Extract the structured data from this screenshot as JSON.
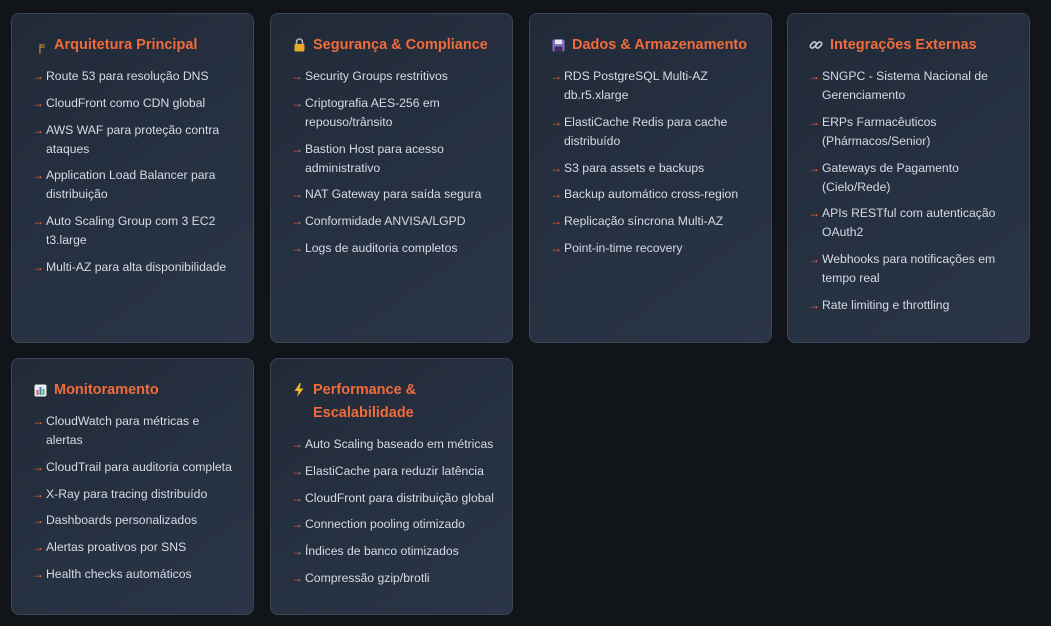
{
  "cards": [
    {
      "title": "Arquitetura Principal",
      "icon": "construction-crane-icon",
      "items": [
        "Route 53 para resolução DNS",
        "CloudFront como CDN global",
        "AWS WAF para proteção contra ataques",
        "Application Load Balancer para distribuição",
        "Auto Scaling Group com 3 EC2 t3.large",
        "Multi-AZ para alta disponibilidade"
      ]
    },
    {
      "title": "Segurança & Compliance",
      "icon": "lock-icon",
      "items": [
        "Security Groups restritivos",
        "Criptografia AES-256 em repouso/trânsito",
        "Bastion Host para acesso administrativo",
        "NAT Gateway para saída segura",
        "Conformidade ANVISA/LGPD",
        "Logs de auditoria completos"
      ]
    },
    {
      "title": "Dados & Armazenamento",
      "icon": "floppy-disk-icon",
      "items": [
        "RDS PostgreSQL Multi-AZ db.r5.xlarge",
        "ElastiCache Redis para cache distribuído",
        "S3 para assets e backups",
        "Backup automático cross-region",
        "Replicação síncrona Multi-AZ",
        "Point-in-time recovery"
      ]
    },
    {
      "title": "Integrações Externas",
      "icon": "link-icon",
      "items": [
        "SNGPC - Sistema Nacional de Gerenciamento",
        "ERPs Farmacêuticos (Phármacos/Senior)",
        "Gateways de Pagamento (Cielo/Rede)",
        "APIs RESTful com autenticação OAuth2",
        "Webhooks para notificações em tempo real",
        "Rate limiting e throttling"
      ]
    },
    {
      "title": "Monitoramento",
      "icon": "bar-chart-icon",
      "items": [
        "CloudWatch para métricas e alertas",
        "CloudTrail para auditoria completa",
        "X-Ray para tracing distribuído",
        "Dashboards personalizados",
        "Alertas proativos por SNS",
        "Health checks automáticos"
      ]
    },
    {
      "title": "Performance & Escalabilidade",
      "icon": "lightning-bolt-icon",
      "items": [
        "Auto Scaling baseado em métricas",
        "ElastiCache para reduzir latência",
        "CloudFront para distribuição global",
        "Connection pooling otimizado",
        "Índices de banco otimizados",
        "Compressão gzip/brotli"
      ]
    }
  ],
  "bullet": "→"
}
